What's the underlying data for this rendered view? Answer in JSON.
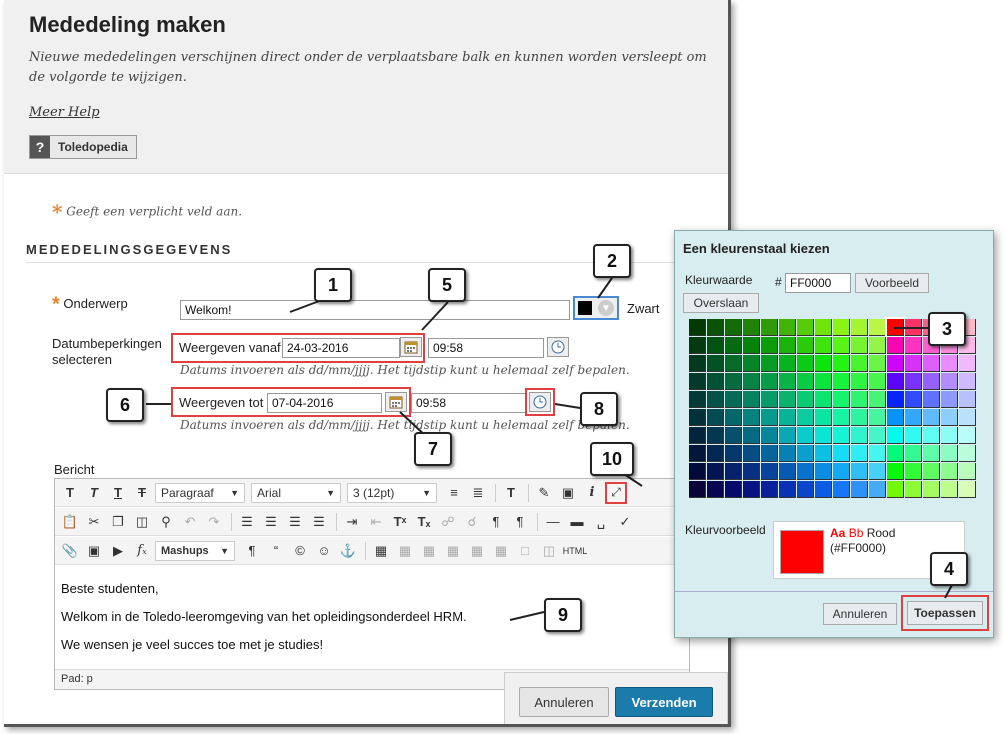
{
  "page": {
    "title": "Mededeling maken",
    "description": "Nieuwe mededelingen verschijnen direct onder de verplaatsbare balk en kunnen worden versleept om de volgorde te wijzigen.",
    "help_link": "Meer Help",
    "toledopedia_button": "Toledopedia",
    "toledopedia_icon": "?"
  },
  "form": {
    "required_note": "Geeft een verplicht veld aan.",
    "required_star": "*",
    "section_title": "MEDEDELINGSGEGEVENS",
    "subject_label": "Onderwerp",
    "subject_value": "Welkom!",
    "color_name": "Zwart",
    "date_restriction_label_1": "Datumbeperkingen",
    "date_restriction_label_2": "selecteren",
    "display_from_label": "Weergeven vanaf",
    "display_from_date": "24-03-2016",
    "display_from_time": "09:58",
    "display_until_label": "Weergeven tot",
    "display_until_date": "07-04-2016",
    "display_until_time": "09:58",
    "date_hint": "Datums invoeren als dd/mm/jjjj. Het tijdstip kunt u helemaal zelf bepalen.",
    "message_label": "Bericht"
  },
  "editor": {
    "paragraph_select": "Paragraaf",
    "font_select": "Arial",
    "size_select": "3 (12pt)",
    "mashups": "Mashups",
    "html_label": "HTML",
    "lines": [
      "Beste studenten,",
      "Welkom in de Toledo-leeromgeving van het opleidingsonderdeel HRM.",
      "We wensen je veel succes toe met je studies!"
    ],
    "path_label": "Pad: p"
  },
  "buttons": {
    "cancel": "Annuleren",
    "submit": "Verzenden"
  },
  "picker": {
    "title": "Een kleurenstaal kiezen",
    "value_label": "Kleurwaarde",
    "hash": "#",
    "value": "FF0000",
    "preview_button": "Voorbeeld",
    "skip_button": "Overslaan",
    "preview_label": "Kleurvoorbeeld",
    "preview_aa": "Aa",
    "preview_bb": "Bb",
    "preview_name": "Rood",
    "preview_hex": "(#FF0000)",
    "cancel_button": "Annuleren",
    "apply_button": "Toepassen"
  },
  "callouts": [
    "1",
    "2",
    "3",
    "4",
    "5",
    "6",
    "7",
    "8",
    "9",
    "10"
  ],
  "colors": {
    "accent_blue": "#1b7bab",
    "highlight_red": "#e04040",
    "dialog_bg": "#d8edf0",
    "required_orange": "#e8822a",
    "selected_color": "#ff0000"
  }
}
